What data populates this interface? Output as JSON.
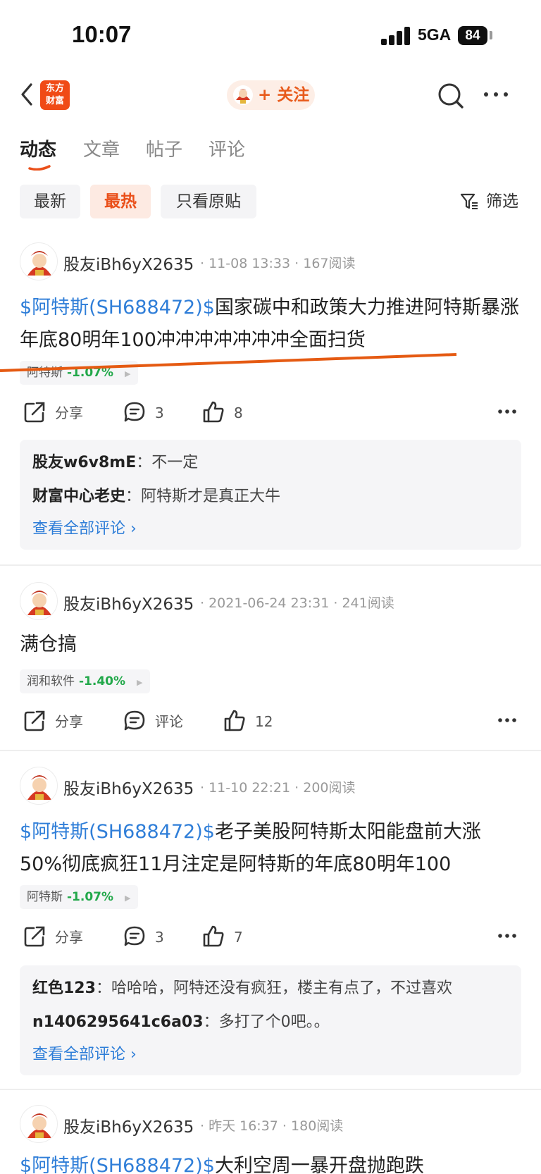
{
  "status_bar": {
    "time": "10:07",
    "network": "5GA",
    "battery": "84"
  },
  "nav": {
    "logo_line1": "东方",
    "logo_line2": "财富",
    "follow_label": "+ 关注"
  },
  "tabs": [
    {
      "label": "动态",
      "active": true
    },
    {
      "label": "文章",
      "active": false
    },
    {
      "label": "帖子",
      "active": false
    },
    {
      "label": "评论",
      "active": false
    }
  ],
  "filters": {
    "chips": [
      {
        "label": "最新",
        "active": false
      },
      {
        "label": "最热",
        "active": true
      },
      {
        "label": "只看原贴",
        "active": false
      }
    ],
    "filter_label": "筛选"
  },
  "posts": [
    {
      "user": "股友iBh6yX2635",
      "time": "11-08 13:33",
      "reads": "167阅读",
      "tag": "$阿特斯(SH688472)$",
      "text": "国家碳中和政策大力推进阿特斯暴涨年底80明年100冲冲冲冲冲冲冲全面扫货",
      "stock_name": "阿特斯",
      "stock_change": "-1.07%",
      "share_label": "分享",
      "comment_count": "3",
      "like_count": "8",
      "comments": [
        {
          "who": "股友w6v8mE",
          "text": "不一定"
        },
        {
          "who": "财富中心老史",
          "text": "阿特斯才是真正大牛"
        }
      ],
      "see_all": "查看全部评论 ›"
    },
    {
      "user": "股友iBh6yX2635",
      "time": "2021-06-24 23:31",
      "reads": "241阅读",
      "text": "满仓搞",
      "stock_name": "润和软件",
      "stock_change": "-1.40%",
      "share_label": "分享",
      "comment_label": "评论",
      "like_count": "12"
    },
    {
      "user": "股友iBh6yX2635",
      "time": "11-10 22:21",
      "reads": "200阅读",
      "tag": "$阿特斯(SH688472)$",
      "text": "老子美股阿特斯太阳能盘前大涨50%彻底疯狂11月注定是阿特斯的年底80明年100",
      "stock_name": "阿特斯",
      "stock_change": "-1.07%",
      "share_label": "分享",
      "comment_count": "3",
      "like_count": "7",
      "comments": [
        {
          "who": "红色123",
          "text": "哈哈哈，阿特还没有疯狂，楼主有点了，不过喜欢"
        },
        {
          "who": "n1406295641c6a03",
          "text": "多打了个0吧。。"
        }
      ],
      "see_all": "查看全部评论 ›"
    },
    {
      "user": "股友iBh6yX2635",
      "time": "昨天 16:37",
      "reads": "180阅读",
      "tag": "$阿特斯(SH688472)$",
      "text": "大利空周一暴开盘抛跑跌"
    }
  ]
}
